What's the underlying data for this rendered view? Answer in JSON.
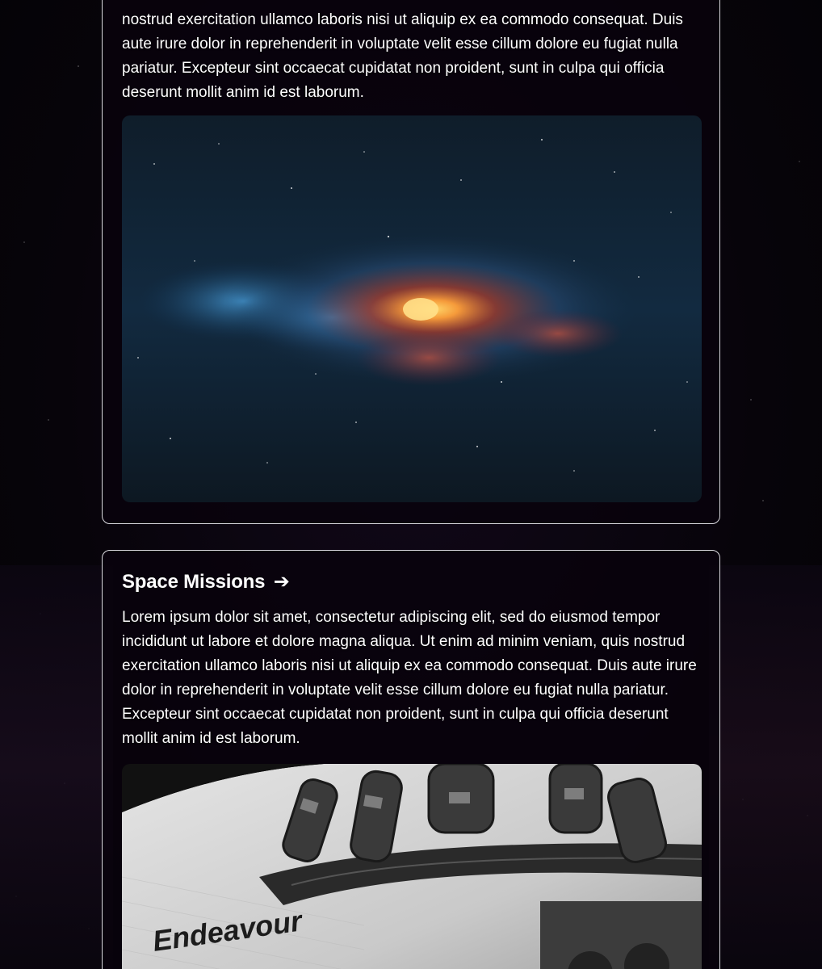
{
  "sections": [
    {
      "title": "",
      "body_visible": "nostrud exercitation ullamco laboris nisi ut aliquip ex ea commodo consequat. Duis aute irure dolor in reprehenderit in voluptate velit esse cillum dolore eu fugiat nulla pariatur. Excepteur sint occaecat cupidatat non proident, sunt in culpa qui officia deserunt mollit anim id est laborum.",
      "image": "milky-way-galaxy-image"
    },
    {
      "title": "Space Missions",
      "arrow": "➔",
      "body": "Lorem ipsum dolor sit amet, consectetur adipiscing elit, sed do eiusmod tempor incididunt ut labore et dolore magna aliqua. Ut enim ad minim veniam, quis nostrud exercitation ullamco laboris nisi ut aliquip ex ea commodo consequat. Duis aute irure dolor in reprehenderit in voluptate velit esse cillum dolore eu fugiat nulla pariatur. Excepteur sint occaecat cupidatat non proident, sunt in culpa qui officia deserunt mollit anim id est laborum.",
      "image": "space-shuttle-image",
      "image_label": "Endeavour"
    }
  ],
  "colors": {
    "background": "#07040a",
    "card_border": "#d9d9de",
    "text": "#ffffff"
  }
}
